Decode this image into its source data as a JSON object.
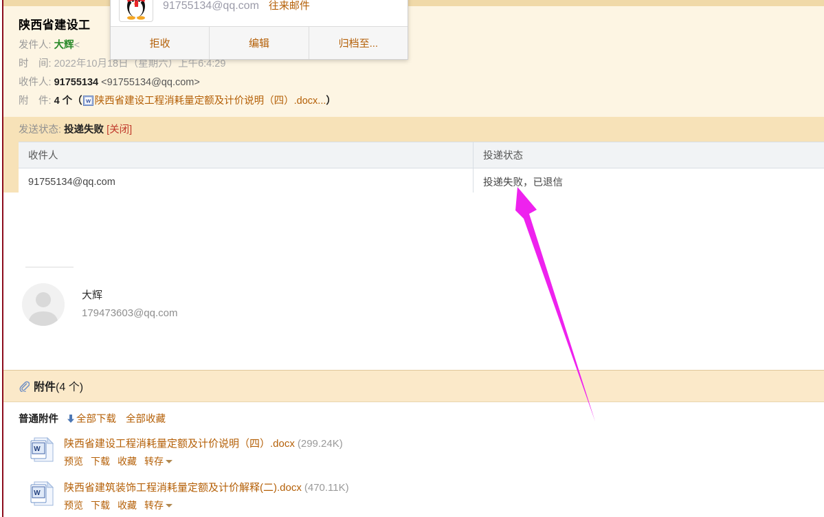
{
  "mail": {
    "subject": "陕西省建设工",
    "from_label": "发件人:",
    "from_name": "大辉",
    "from_bracket_open": "<",
    "time_label": "时　间:",
    "time_value": "2022年10月18日（星期六）上午6:4:29",
    "to_label": "收件人:",
    "to_name": "91755134",
    "to_address": "<91755134@qq.com>",
    "attach_label": "附　件:",
    "attach_count_text": "4 个（",
    "attach_first_name": "陕西省建设工程消耗量定额及计价说明（四）.docx...",
    "attach_paren_close": "）"
  },
  "popup": {
    "email": "91755134@qq.com",
    "history_link": "往来邮件",
    "buttons": [
      {
        "label": "拒收",
        "name": "reject-button"
      },
      {
        "label": "编辑",
        "name": "edit-button"
      },
      {
        "label": "归档至...",
        "name": "archive-to-button"
      }
    ]
  },
  "delivery": {
    "status_label": "发送状态:",
    "status_value": "投递失败",
    "close_link": "[关闭]",
    "columns": [
      "收件人",
      "投递状态"
    ],
    "rows": [
      {
        "recipient": "91755134@qq.com",
        "status": "投递失败，已退信"
      }
    ]
  },
  "signature": {
    "name": "大辉",
    "email": "179473603@qq.com"
  },
  "attachments": {
    "panel_title": "附件",
    "panel_count": "(4 个)",
    "section_title": "普通附件",
    "download_all": "全部下载",
    "favorite_all": "全部收藏",
    "items": [
      {
        "name": "陕西省建设工程消耗量定额及计价说明（四）.docx",
        "size": "(299.24K)",
        "actions": [
          "预览",
          "下载",
          "收藏",
          "转存"
        ]
      },
      {
        "name": "陕西省建筑装饰工程消耗量定额及计价解释(二).docx",
        "size": "(470.11K)",
        "actions": [
          "预览",
          "下载",
          "收藏",
          "转存"
        ]
      }
    ]
  },
  "colors": {
    "header_bg": "#fdf5e3",
    "status_bg": "#f7e2b8",
    "link": "#b45f06",
    "fail_red": "#d40000",
    "accent_border": "#8b0a1a",
    "annotation": "#ee22ee"
  }
}
